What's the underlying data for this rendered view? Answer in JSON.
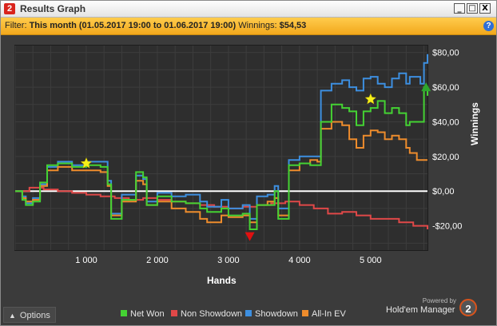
{
  "window": {
    "title": "Results Graph",
    "logo_text": "2",
    "controls": {
      "minimize": "_",
      "maximize": "□",
      "close": "X"
    }
  },
  "filter": {
    "label": "Filter:",
    "period": "This month (01.05.2017 19:00 to 01.06.2017 19:00)",
    "winnings_label": "Winnings:",
    "winnings_value": "$54,53",
    "help_icon": "?"
  },
  "footer": {
    "options_label": "Options",
    "options_icon": "caret-up-icon",
    "powered_by": "Powered by",
    "brand": "Hold'em Manager",
    "brand_badge": "2"
  },
  "colors": {
    "net_won": "#44d233",
    "non_showdown": "#e04848",
    "showdown": "#3d8fe0",
    "all_in_ev": "#ee8c2c",
    "zero_line": "#ffffff",
    "star": "#f6f01a",
    "up_marker": "#2ea62e",
    "down_marker": "#e01010"
  },
  "chart_data": {
    "type": "line",
    "xlabel": "Hands",
    "ylabel": "Winnings",
    "xlim": [
      0,
      5800
    ],
    "ylim": [
      -34,
      84
    ],
    "x_ticks": [
      1000,
      2000,
      3000,
      4000,
      5000
    ],
    "x_tick_labels": [
      "1 000",
      "2 000",
      "3 000",
      "4 000",
      "5 000"
    ],
    "y_ticks": [
      80,
      60,
      40,
      20,
      0,
      -20
    ],
    "y_tick_labels": [
      "$80,00",
      "$60,00",
      "$40,00",
      "$20,00",
      "$0,00",
      "-$20,00"
    ],
    "grid": true,
    "legend_position": "bottom",
    "series": [
      {
        "name": "Net Won",
        "x": [
          0,
          100,
          150,
          250,
          350,
          450,
          600,
          800,
          1000,
          1200,
          1300,
          1350,
          1500,
          1700,
          1800,
          1850,
          2000,
          2200,
          2400,
          2600,
          2700,
          2900,
          3000,
          3200,
          3300,
          3400,
          3550,
          3650,
          3700,
          3850,
          4000,
          4150,
          4250,
          4300,
          4450,
          4600,
          4700,
          4800,
          4900,
          5000,
          5100,
          5200,
          5300,
          5400,
          5500,
          5550,
          5650,
          5750,
          5800
        ],
        "values": [
          0,
          -5,
          -8,
          -6,
          5,
          15,
          16,
          14,
          15,
          14,
          4,
          -16,
          -5,
          11,
          8,
          -8,
          -3,
          -6,
          -7,
          -10,
          -12,
          -10,
          -14,
          -13,
          -22,
          -8,
          -8,
          0,
          -16,
          15,
          16,
          15,
          15,
          40,
          50,
          48,
          46,
          38,
          46,
          48,
          52,
          45,
          48,
          45,
          38,
          40,
          40,
          60,
          55
        ]
      },
      {
        "name": "Non Showdown",
        "x": [
          0,
          200,
          400,
          600,
          800,
          1000,
          1200,
          1400,
          1600,
          1800,
          2000,
          2200,
          2400,
          2600,
          2800,
          3000,
          3200,
          3400,
          3600,
          3800,
          4000,
          4200,
          4400,
          4600,
          4800,
          5000,
          5200,
          5400,
          5600,
          5800
        ],
        "values": [
          0,
          2,
          1,
          0,
          -1,
          -2,
          -3,
          -4,
          -5,
          -4,
          -5,
          -6,
          -7,
          -8,
          -9,
          -10,
          -9,
          -8,
          -7,
          -6,
          -8,
          -10,
          -13,
          -12,
          -14,
          -16,
          -16,
          -18,
          -20,
          -22
        ]
      },
      {
        "name": "Showdown",
        "x": [
          0,
          100,
          150,
          250,
          350,
          450,
          600,
          800,
          1000,
          1200,
          1300,
          1350,
          1500,
          1700,
          1800,
          1850,
          2000,
          2200,
          2400,
          2600,
          2700,
          2900,
          3000,
          3200,
          3300,
          3400,
          3550,
          3650,
          3700,
          3850,
          4000,
          4150,
          4250,
          4300,
          4450,
          4600,
          4700,
          4800,
          4900,
          5000,
          5100,
          5200,
          5300,
          5400,
          5500,
          5550,
          5650,
          5700,
          5750,
          5800
        ],
        "values": [
          0,
          -3,
          -7,
          -4,
          4,
          14,
          17,
          15,
          17,
          17,
          6,
          -13,
          -2,
          9,
          7,
          -6,
          -1,
          -3,
          -2,
          -6,
          -9,
          -5,
          -10,
          -8,
          -16,
          -3,
          -2,
          3,
          -10,
          18,
          20,
          20,
          20,
          58,
          62,
          64,
          60,
          58,
          65,
          66,
          62,
          60,
          65,
          68,
          62,
          66,
          66,
          62,
          74,
          79
        ]
      },
      {
        "name": "All-In EV",
        "x": [
          0,
          100,
          150,
          250,
          350,
          450,
          600,
          800,
          1000,
          1200,
          1300,
          1350,
          1500,
          1700,
          1800,
          1850,
          2000,
          2200,
          2400,
          2600,
          2700,
          2900,
          3000,
          3200,
          3300,
          3400,
          3550,
          3650,
          3700,
          3850,
          4000,
          4150,
          4250,
          4300,
          4450,
          4600,
          4700,
          4800,
          4900,
          5000,
          5100,
          5200,
          5300,
          5400,
          5500,
          5550,
          5650,
          5750,
          5800
        ],
        "values": [
          0,
          -4,
          -6,
          -5,
          3,
          12,
          14,
          12,
          12,
          11,
          3,
          -14,
          -6,
          6,
          4,
          -8,
          -6,
          -10,
          -12,
          -16,
          -18,
          -14,
          -15,
          -14,
          -18,
          -8,
          -6,
          -4,
          -14,
          12,
          16,
          18,
          17,
          36,
          40,
          38,
          30,
          25,
          32,
          35,
          34,
          30,
          32,
          30,
          25,
          22,
          18,
          18,
          18
        ]
      }
    ],
    "markers": [
      {
        "type": "star",
        "x": 1000,
        "y": 16
      },
      {
        "type": "star",
        "x": 5000,
        "y": 53
      },
      {
        "type": "triangle-up",
        "x": 5780,
        "y": 60
      },
      {
        "type": "triangle-down",
        "x": 3300,
        "y": -26
      }
    ]
  }
}
